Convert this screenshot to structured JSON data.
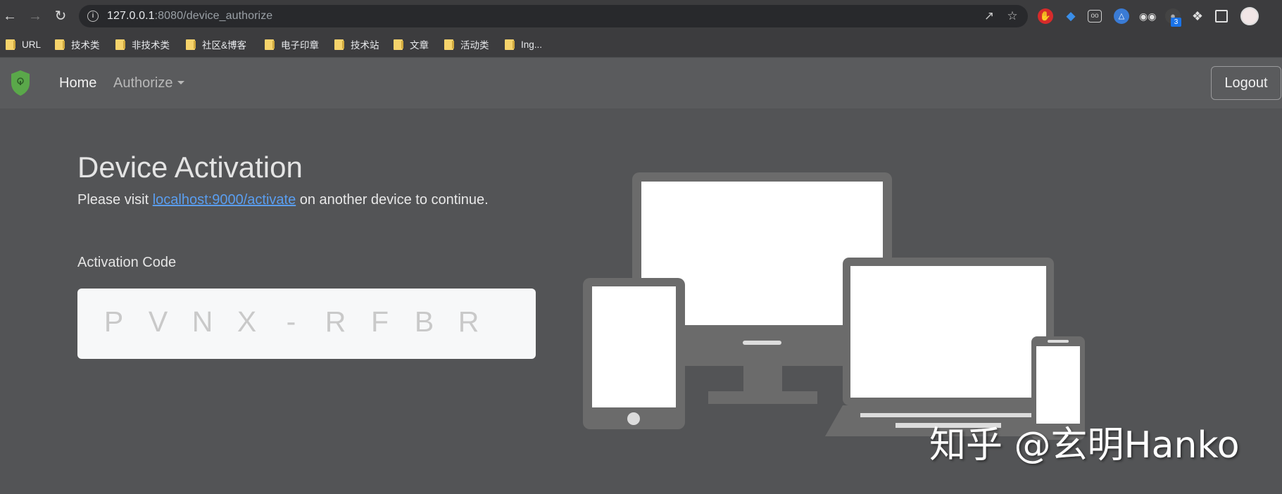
{
  "browser": {
    "url_host": "127.0.0.1",
    "url_rest": ":8080/device_authorize",
    "bookmarks": [
      "URL",
      "技术类",
      "非技术类",
      "社区&博客",
      "电子印章",
      "技术站",
      "文章",
      "活动类",
      "Ing..."
    ],
    "extension_badge": "3"
  },
  "navbar": {
    "home": "Home",
    "authorize": "Authorize",
    "logout": "Logout"
  },
  "main": {
    "title": "Device Activation",
    "subtitle_pre": "Please visit ",
    "subtitle_link": "localhost:9000/activate",
    "subtitle_post": " on another device to continue.",
    "code_label": "Activation Code",
    "code_chars": [
      "P",
      "V",
      "N",
      "X",
      "-",
      "R",
      "F",
      "B",
      "R"
    ]
  },
  "watermark": "知乎 @玄明Hanko",
  "colors": {
    "shield": "#5aa84a",
    "link": "#5a9ef0",
    "device_gray": "#6b6b6b"
  }
}
